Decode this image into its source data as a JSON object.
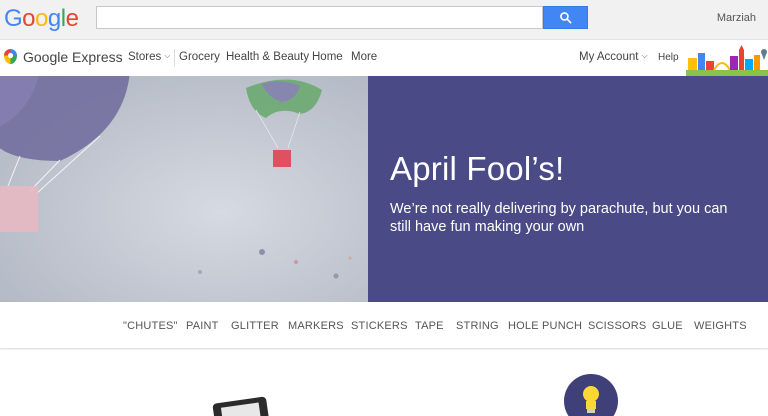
{
  "google_bar": {
    "logo_letters": [
      "G",
      "o",
      "o",
      "g",
      "l",
      "e"
    ],
    "logo_colors": [
      "#4285f4",
      "#ea4335",
      "#fbbc05",
      "#4285f4",
      "#34a853",
      "#ea4335"
    ],
    "search": {
      "value": "",
      "placeholder": ""
    },
    "search_icon": "magnifier-icon",
    "user_name": "Marziah"
  },
  "express_nav": {
    "brand": "Google Express",
    "items": [
      {
        "label": "Stores",
        "has_dropdown": true
      },
      {
        "label": "Grocery"
      },
      {
        "label": "Health & Beauty"
      },
      {
        "label": "Home"
      },
      {
        "label": "More"
      }
    ],
    "account": {
      "label": "My Account",
      "has_dropdown": true
    },
    "help": "Help",
    "illustration_icon": "city-skyline-icon"
  },
  "hero": {
    "title": "April Fool’s!",
    "subtitle": "We’re not really delivering by parachute, but you can still have fun making your own",
    "panel_color": "#4a4a87"
  },
  "categories": [
    "\"CHUTES\"",
    "PAINT",
    "GLITTER",
    "MARKERS",
    "STICKERS",
    "TAPE",
    "STRING",
    "HOLE PUNCH",
    "SCISSORS",
    "GLUE",
    "WEIGHTS"
  ],
  "lower": {
    "icons": [
      "phone-icon",
      "lightbulb-icon"
    ]
  }
}
